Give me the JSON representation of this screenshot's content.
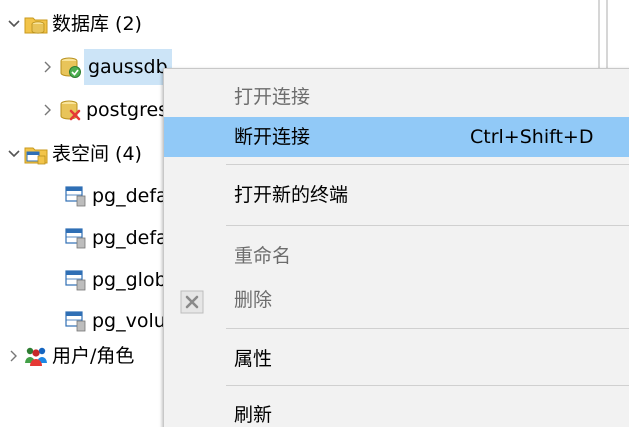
{
  "tree": {
    "databases": {
      "label": "数据库 (2)"
    },
    "db_items": [
      {
        "label": "gaussdb"
      },
      {
        "label": "postgres"
      }
    ],
    "tablespaces": {
      "label": "表空间 (4)"
    },
    "tablespace_items": [
      {
        "label": "pg_default"
      },
      {
        "label": "pg_default"
      },
      {
        "label": "pg_global"
      },
      {
        "label": "pg_volume"
      }
    ],
    "users": {
      "label": "用户/角色"
    }
  },
  "menu": {
    "open_connection": "打开连接",
    "disconnect": "断开连接",
    "disconnect_shortcut": "Ctrl+Shift+D",
    "open_new_terminal": "打开新的终端",
    "rename": "重命名",
    "delete": "删除",
    "properties": "属性",
    "refresh": "刷新"
  },
  "colors": {
    "selection": "#cce4f7",
    "menu_hover": "#91c9f7",
    "menu_bg": "#f2f2f2",
    "folder": "#f2c44a",
    "db_green": "#4caf50",
    "db_red": "#e53935"
  }
}
